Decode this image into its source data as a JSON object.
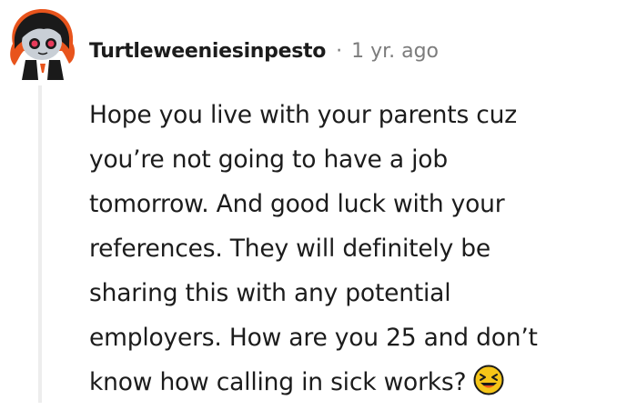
{
  "comment": {
    "author": "Turtleweeniesinpesto",
    "separator": "·",
    "timestamp": "1 yr. ago",
    "avatar_icon": "goth-avatar-icon",
    "body_lines": [
      "Hope you live with your parents cuz",
      "you’re not going to have a job",
      "tomorrow. And good luck with your",
      "references. They will definitely be",
      "sharing this with any potential",
      "employers. How are you 25 and don’t",
      "know how calling in sick works?"
    ],
    "emoji_icon": "laughing-face-icon"
  },
  "colors": {
    "text": "#1c1c1c",
    "meta": "#7c7c7c",
    "thread_line": "#ededed",
    "avatar_hair": "#e8541c",
    "emoji_face": "#f5c518"
  }
}
